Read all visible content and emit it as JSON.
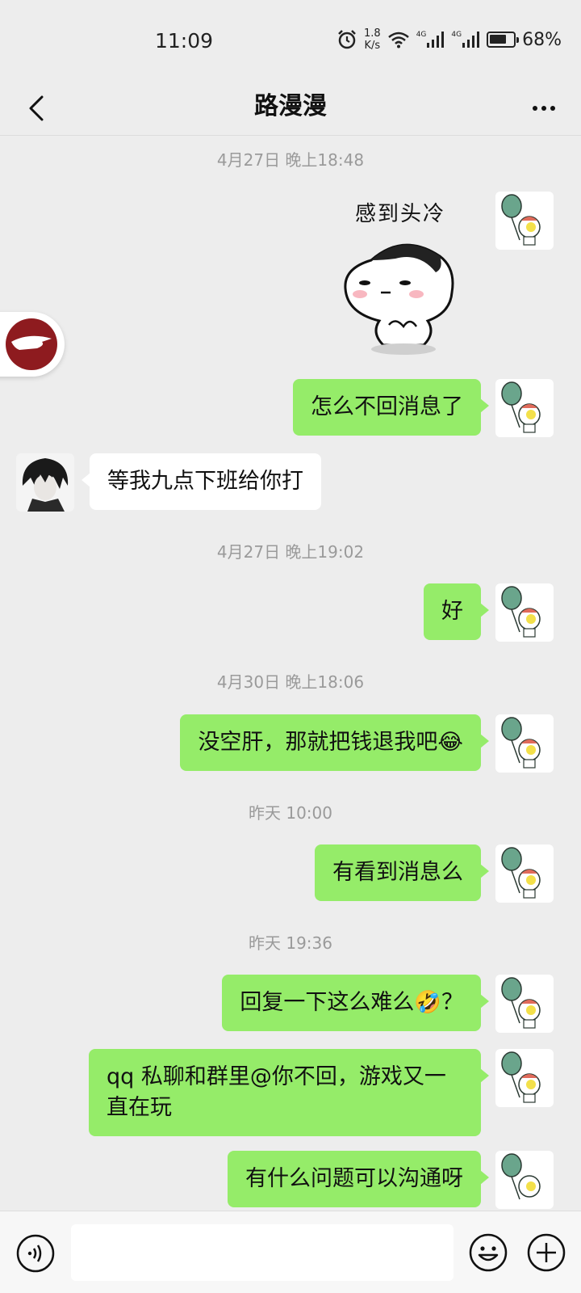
{
  "status_bar": {
    "time": "11:09",
    "net_speed_value": "1.8",
    "net_speed_unit": "K/s",
    "signal_1_label": "4G",
    "signal_2_label": "4G",
    "battery": "68%"
  },
  "header": {
    "title": "路漫漫",
    "back_icon": "chevron-left-icon",
    "more_icon": "more-dots-icon"
  },
  "sticker": {
    "caption": "感到头冷"
  },
  "messages": [
    {
      "type": "timestamp",
      "text": "4月27日 晚上18:48"
    },
    {
      "type": "sticker",
      "from": "me"
    },
    {
      "type": "text",
      "from": "me",
      "text": "怎么不回消息了"
    },
    {
      "type": "text",
      "from": "them",
      "text": "等我九点下班给你打"
    },
    {
      "type": "timestamp",
      "text": "4月27日 晚上19:02"
    },
    {
      "type": "text",
      "from": "me",
      "text": "好"
    },
    {
      "type": "timestamp",
      "text": "4月30日 晚上18:06"
    },
    {
      "type": "text",
      "from": "me",
      "text": "没空肝，那就把钱退我吧😂"
    },
    {
      "type": "timestamp",
      "text": "昨天 10:00"
    },
    {
      "type": "text",
      "from": "me",
      "text": "有看到消息么"
    },
    {
      "type": "timestamp",
      "text": "昨天 19:36"
    },
    {
      "type": "text",
      "from": "me",
      "text": "回复一下这么难么🤣？"
    },
    {
      "type": "text",
      "from": "me",
      "text": "qq 私聊和群里@你不回，游戏又一直在玩"
    },
    {
      "type": "text",
      "from": "me",
      "text": "有什么问题可以沟通呀"
    }
  ],
  "input_bar": {
    "voice_icon": "voice-icon",
    "input_value": "",
    "emoji_icon": "emoji-icon",
    "plus_icon": "plus-icon"
  },
  "colors": {
    "background": "#ededed",
    "my_bubble": "#95ec69",
    "their_bubble": "#ffffff",
    "timestamp_text": "#9a9a9a"
  }
}
